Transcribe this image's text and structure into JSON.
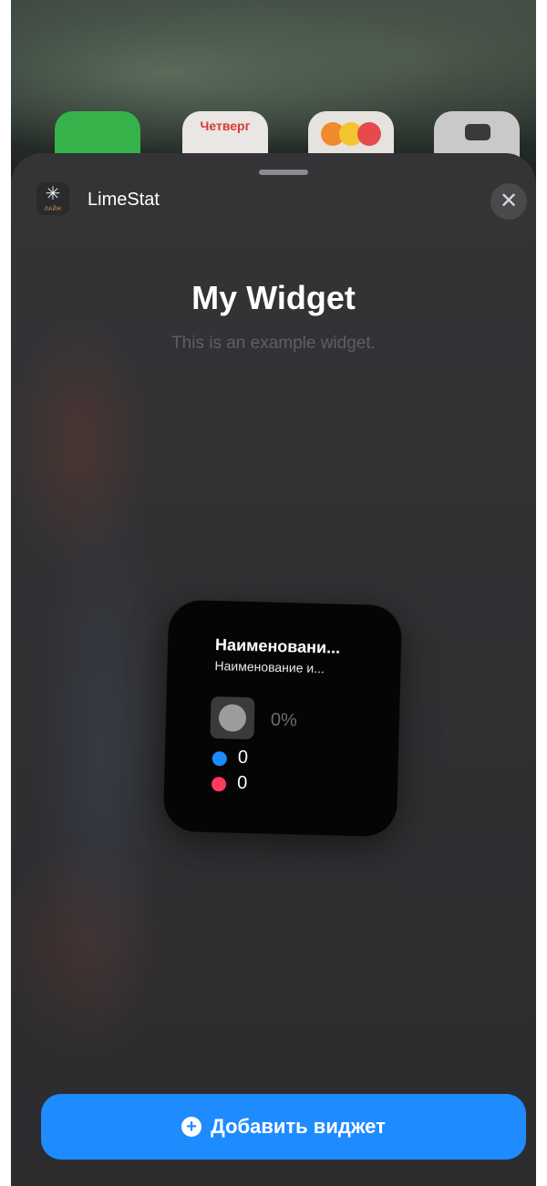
{
  "home_screen": {
    "calendar_day": "Четверг"
  },
  "sheet": {
    "app_name": "LimeStat",
    "close_symbol": "✕",
    "title": "My Widget",
    "subtitle": "This is an example widget.",
    "widget": {
      "name": "Наименовани...",
      "subname": "Наименование и...",
      "percent": "0%",
      "blue_value": "0",
      "red_value": "0"
    },
    "add_button_label": "Добавить виджет",
    "add_button_symbol": "+"
  },
  "colors": {
    "accent": "#1e8cff",
    "blue_dot": "#1a8cff",
    "red_dot": "#ff3b5c",
    "sheet_bg": "#303033"
  },
  "icons": [
    "app-icon",
    "close-icon",
    "plus-circle-icon"
  ]
}
